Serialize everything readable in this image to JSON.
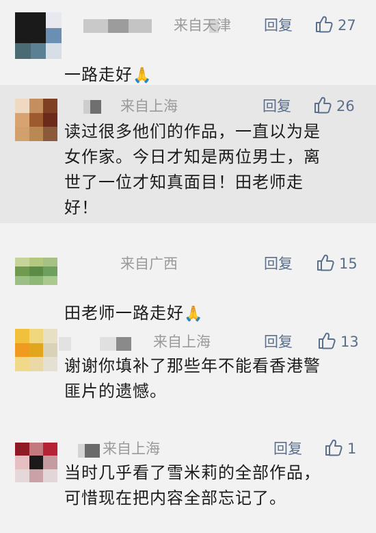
{
  "labels": {
    "reply": "回复"
  },
  "comments": [
    {
      "location": "来自天津",
      "likes": "27",
      "text": "一路走好",
      "emoji": "🙏",
      "avatar_colors": [
        "#1a1a1a",
        "#1a1a1a",
        "#e8e8f0",
        "#1a1a1a",
        "#1a1a1a",
        "#6b8fb3",
        "#4a6a74",
        "#5b7f93",
        "#d8dee6"
      ]
    },
    {
      "location": "来自上海",
      "likes": "26",
      "text": "读过很多他们的作品，一直以为是\n女作家。今日才知是两位男士，离\n世了一位才知真面目！田老师走\n好！",
      "emoji": "",
      "avatar_colors": [
        "#efd9c0",
        "#c58e5e",
        "#7e3f22",
        "#d8a271",
        "#9c5a2e",
        "#6b2a1a",
        "#d2a06c",
        "#b98954",
        "#8a5a3a"
      ]
    },
    {
      "location": "来自广西",
      "likes": "15",
      "text": "田老师一路走好",
      "emoji": "🙏",
      "avatar_colors": [
        "#c6d49a",
        "#b3c77f",
        "#a7c083",
        "#6f9a4f",
        "#5c8b45",
        "#6da05f",
        "#9bbf84",
        "#8fb775",
        "#a9c98f"
      ]
    },
    {
      "location": "来自上海",
      "likes": "13",
      "text": "谢谢你填补了那些年不能看香港警\n匪片的遗憾。",
      "emoji": "",
      "avatar_colors": [
        "#f1c13d",
        "#f0d77e",
        "#e8e0c4",
        "#ef9b1f",
        "#e2a51e",
        "#d9d1b8",
        "#f1d98a",
        "#ead9a6",
        "#e5e1d2"
      ]
    },
    {
      "location": "来自上海",
      "likes": "1",
      "text": "当时几乎看了雪米莉的全部作品，\n可惜现在把内容全部忘记了。",
      "emoji": "",
      "avatar_colors": [
        "#8f1a24",
        "#c27a7f",
        "#b52434",
        "#e6bfc3",
        "#1a1a1a",
        "#c39ba0",
        "#e4d8da",
        "#caa1a6",
        "#e2d6d8"
      ]
    }
  ]
}
